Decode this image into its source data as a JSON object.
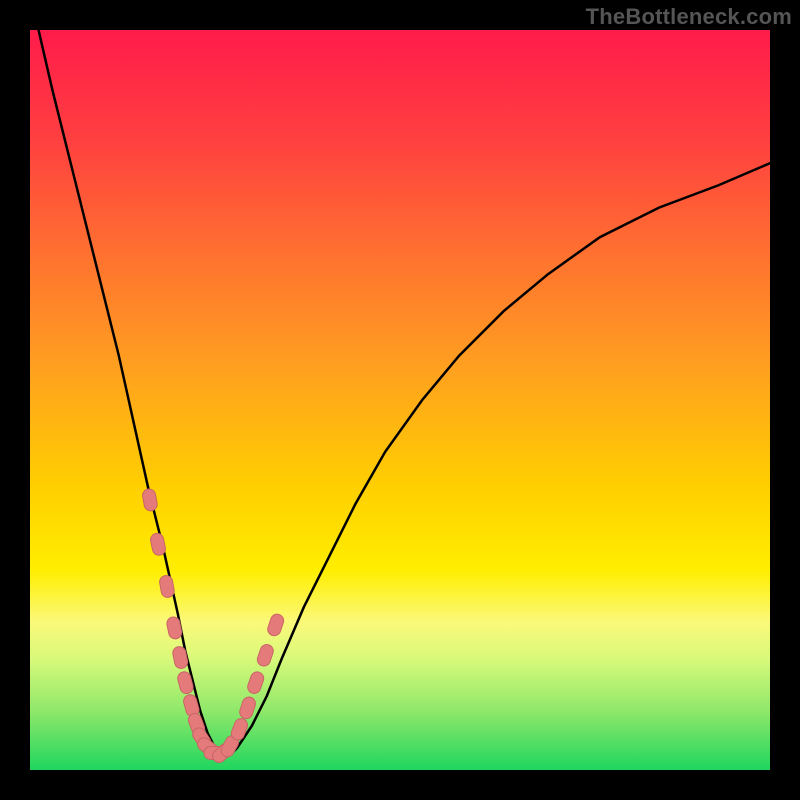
{
  "watermark": "TheBottleneck.com",
  "colors": {
    "curve_stroke": "#000000",
    "glyph_fill": "#e47a7a",
    "glyph_stroke": "#c96565",
    "frame": "#000000"
  },
  "chart_data": {
    "type": "line",
    "title": "",
    "xlabel": "",
    "ylabel": "",
    "xlim": [
      0,
      100
    ],
    "ylim": [
      0,
      100
    ],
    "grid": false,
    "legend": false,
    "series": [
      {
        "name": "bottleneck-curve",
        "x": [
          0,
          3,
          6,
          9,
          12,
          14,
          16,
          18,
          20,
          21,
          22,
          23,
          24,
          25,
          26,
          27,
          28,
          30,
          32,
          34,
          37,
          40,
          44,
          48,
          53,
          58,
          64,
          70,
          77,
          85,
          93,
          100
        ],
        "y": [
          105,
          92,
          80,
          68,
          56,
          47,
          38,
          30,
          21,
          16,
          12,
          8,
          5,
          3,
          2,
          2,
          3,
          6,
          10,
          15,
          22,
          28,
          36,
          43,
          50,
          56,
          62,
          67,
          72,
          76,
          79,
          82
        ]
      }
    ],
    "glyphs": {
      "name": "bead-markers",
      "x": [
        16.2,
        17.3,
        18.5,
        19.5,
        20.3,
        21.0,
        21.8,
        22.5,
        23.2,
        24.0,
        25.0,
        26.0,
        27.0,
        28.3,
        29.4,
        30.5,
        31.8,
        33.2
      ],
      "y": [
        36.5,
        30.5,
        24.8,
        19.2,
        15.2,
        11.8,
        8.7,
        6.2,
        4.3,
        3.1,
        2.3,
        2.3,
        3.2,
        5.5,
        8.4,
        11.8,
        15.5,
        19.6
      ]
    }
  }
}
